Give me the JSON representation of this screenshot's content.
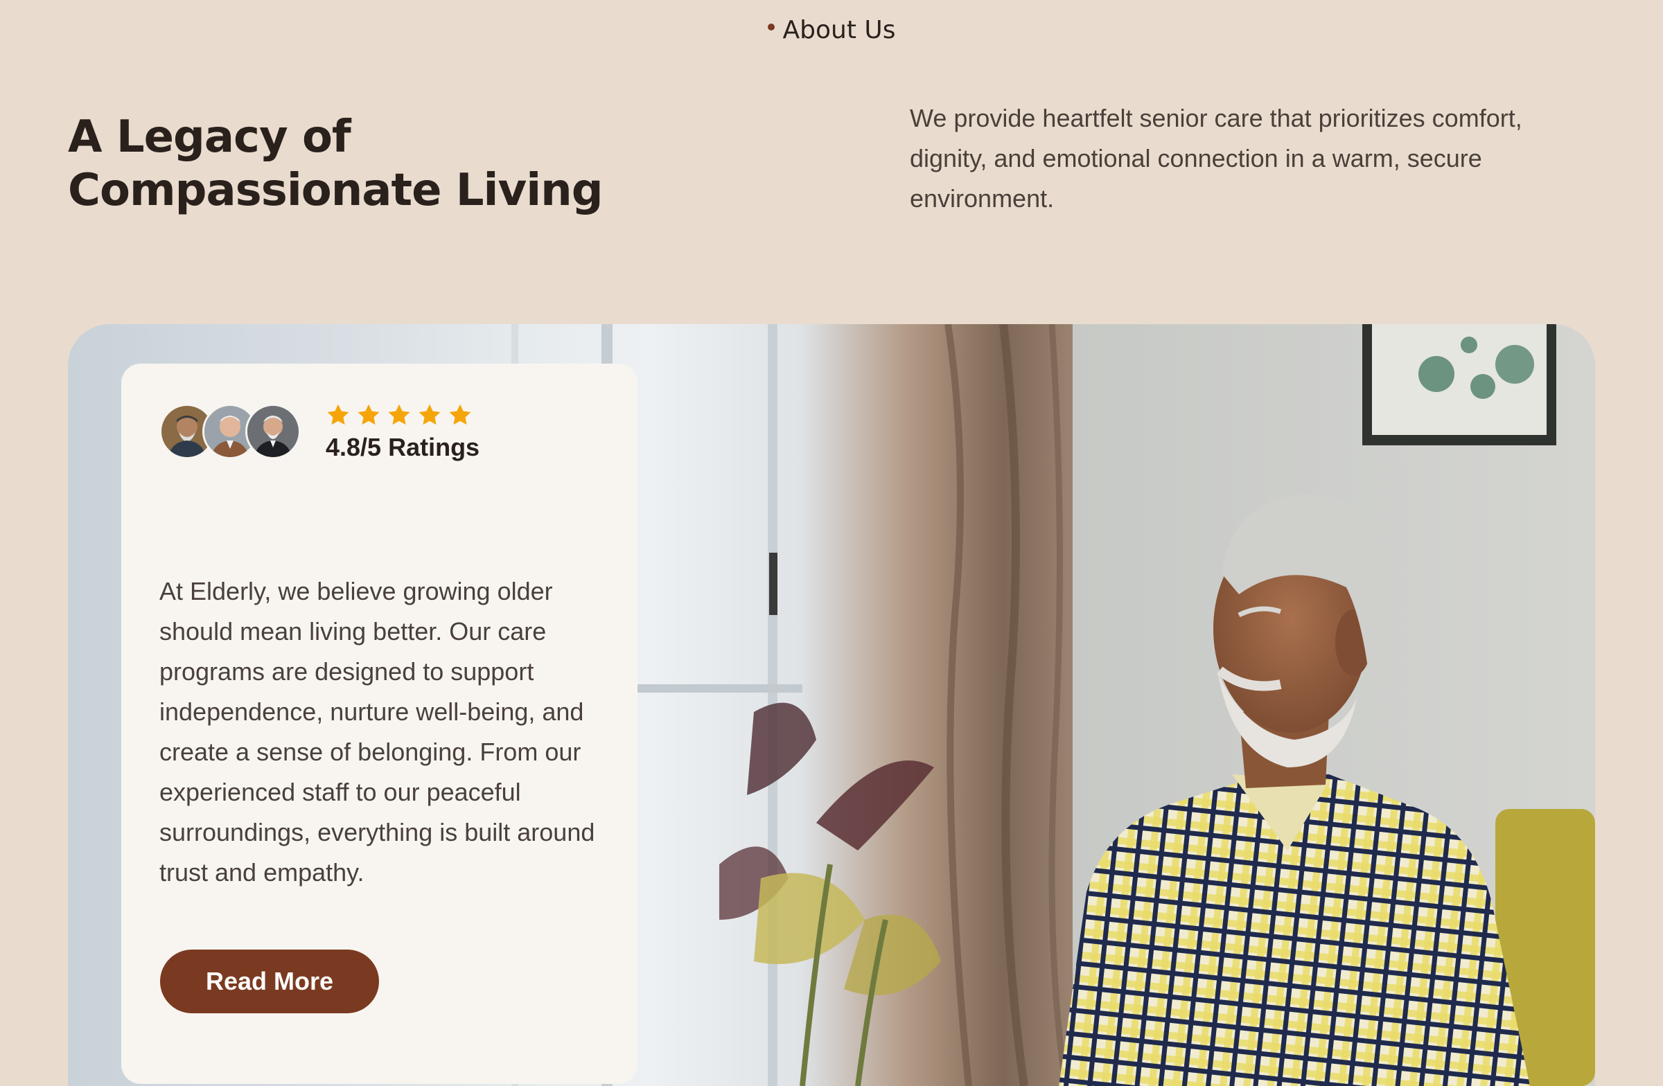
{
  "section": {
    "eyebrow": "About Us",
    "headline_line1": "A Legacy of",
    "headline_line2": "Compassionate Living",
    "intro": "We provide heartfelt senior care that prioritizes comfort, dignity, and emotional connection in a warm, secure environment."
  },
  "card": {
    "rating_text": "4.8/5 Ratings",
    "stars": 5,
    "body": "At Elderly, we believe growing older should mean living better. Our care programs are designed to support independence, nurture well-being, and create a sense of belonging. From our experienced staff to our peaceful surroundings, everything is built around trust and empathy.",
    "button_label": "Read More"
  },
  "colors": {
    "page_background": "#e9dccf",
    "card_background": "#f8f5f0",
    "accent": "#7a3a21",
    "star": "#f5a50a",
    "heading": "#2a211d",
    "body_text": "#4a403a"
  },
  "icons": {
    "eyebrow_marker": "dot-icon",
    "rating": "star-icon"
  }
}
